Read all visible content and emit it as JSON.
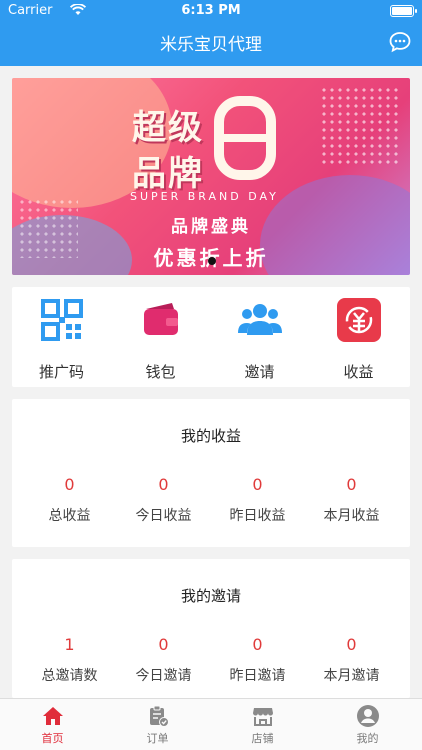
{
  "status_bar": {
    "carrier": "Carrier",
    "time": "6:13 PM"
  },
  "nav": {
    "title": "米乐宝贝代理",
    "chat_icon": "chat-bubble-icon"
  },
  "banner": {
    "headline_1": "超级",
    "headline_2": "品牌",
    "english": "SUPER BRAND DAY",
    "subtitle": "品牌盛典",
    "slogan": "优惠折上折"
  },
  "actions": [
    {
      "label": "推广码",
      "icon": "qrcode-icon",
      "color": "#2f9bf0"
    },
    {
      "label": "钱包",
      "icon": "wallet-icon",
      "color": "#e02c6e"
    },
    {
      "label": "邀请",
      "icon": "users-icon",
      "color": "#2f9bf0"
    },
    {
      "label": "收益",
      "icon": "yuan-cycle-icon",
      "color": "#e83a4a"
    }
  ],
  "earnings": {
    "title": "我的收益",
    "stats": [
      {
        "value": "0",
        "label": "总收益"
      },
      {
        "value": "0",
        "label": "今日收益"
      },
      {
        "value": "0",
        "label": "昨日收益"
      },
      {
        "value": "0",
        "label": "本月收益"
      }
    ]
  },
  "invites": {
    "title": "我的邀请",
    "stats": [
      {
        "value": "1",
        "label": "总邀请数"
      },
      {
        "value": "0",
        "label": "今日邀请"
      },
      {
        "value": "0",
        "label": "昨日邀请"
      },
      {
        "value": "0",
        "label": "本月邀请"
      }
    ]
  },
  "tabbar": [
    {
      "label": "首页",
      "icon": "home-icon",
      "active": true
    },
    {
      "label": "订单",
      "icon": "order-clipboard-icon",
      "active": false
    },
    {
      "label": "店铺",
      "icon": "store-icon",
      "active": false
    },
    {
      "label": "我的",
      "icon": "profile-icon",
      "active": false
    }
  ],
  "colors": {
    "primary": "#2f9bf0",
    "accent_red": "#e03a3a",
    "tab_active": "#e02c3a"
  }
}
